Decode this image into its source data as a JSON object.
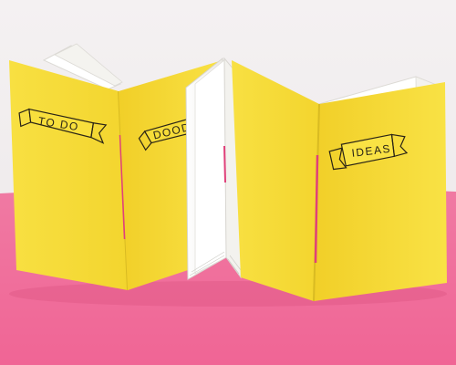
{
  "photo": {
    "colors": {
      "background_wall": "#f1edee",
      "pink_surface": "#f1739f",
      "yellow_cover": "#f8de3a",
      "yellow_shade": "#e5c72a",
      "paper": "#fbfaf7",
      "stitch_thread": "#e0407a",
      "ink": "#2a2416"
    },
    "notebooks": [
      {
        "label": "TO DO"
      },
      {
        "label": "DOODLE"
      },
      {
        "label": "IDEAS"
      }
    ]
  }
}
